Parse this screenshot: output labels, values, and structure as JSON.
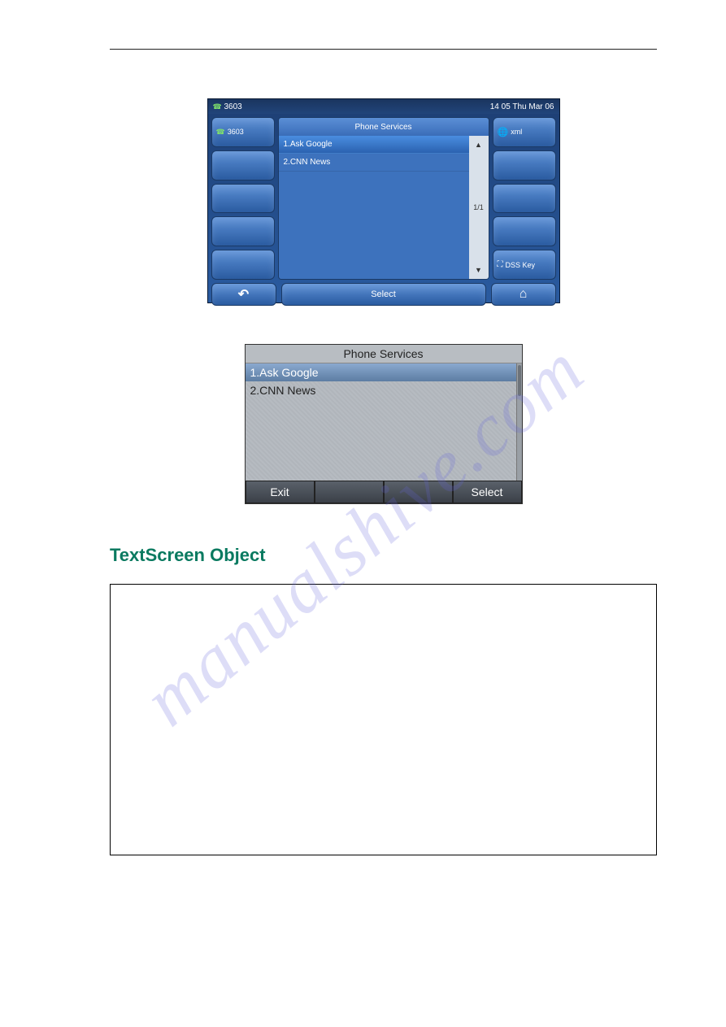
{
  "phone1": {
    "status_ext": "3603",
    "status_time": "14 05 Thu Mar 06",
    "left_label": "3603",
    "title": "Phone Services",
    "items": [
      "1.Ask Google",
      "2.CNN News"
    ],
    "scroll_page": "1/1",
    "right_xml": "xml",
    "right_dss": "DSS Key",
    "bottom_select": "Select"
  },
  "phone2": {
    "title": "Phone Services",
    "items": [
      "1.Ask Google",
      "2.CNN News"
    ],
    "bottom_exit": "Exit",
    "bottom_select": "Select"
  },
  "section_title": "TextScreen Object",
  "watermark": "manualshive.com"
}
